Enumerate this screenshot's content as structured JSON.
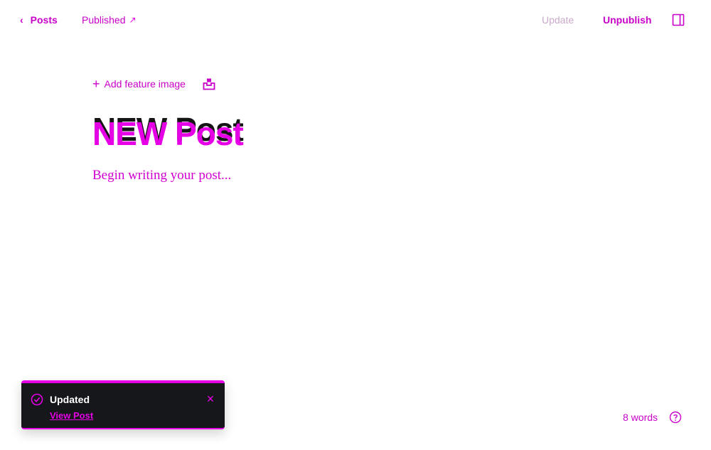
{
  "header": {
    "back_label": "Posts",
    "status_label": "Published",
    "update_label": "Update",
    "unpublish_label": "Unpublish"
  },
  "editor": {
    "add_feature_image_label": "Add feature image",
    "title": "NEW Post",
    "body_placeholder": "Begin writing your post..."
  },
  "toast": {
    "title": "Updated",
    "link_label": "View Post"
  },
  "footer": {
    "word_count": "8 words"
  },
  "icons": {
    "back": "chevron-left-icon",
    "status": "external-link-icon",
    "sidebar": "sidebar-toggle-icon",
    "feature_add": "plus-icon",
    "unsplash": "unsplash-icon",
    "toast_check": "check-circle-icon",
    "toast_close": "close-icon",
    "help": "help-circle-icon"
  },
  "colors": {
    "accent": "#e600e6",
    "text_dark": "#151515",
    "toast_bg": "#15171a",
    "update_disabled": "#c9a9c9"
  }
}
